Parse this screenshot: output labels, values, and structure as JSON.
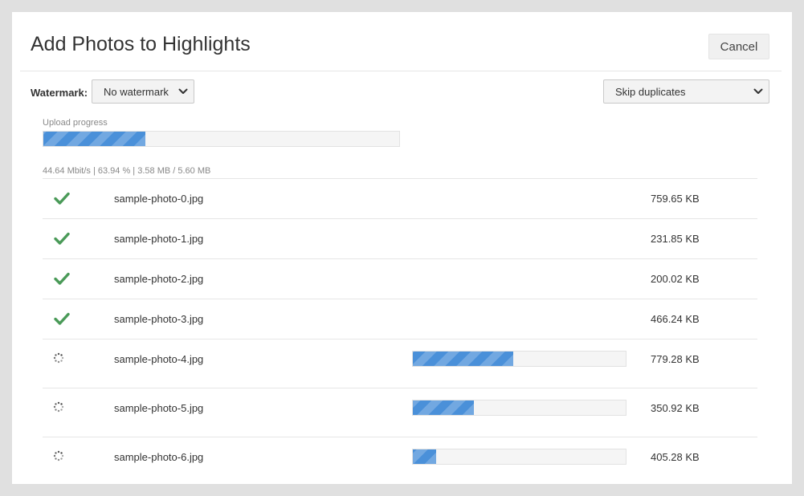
{
  "dialog": {
    "title": "Add Photos to Highlights",
    "cancel_label": "Cancel"
  },
  "options": {
    "watermark_label": "Watermark:",
    "watermark_value": "No watermark",
    "duplicates_value": "Skip duplicates"
  },
  "upload": {
    "caption": "Upload progress",
    "progress": 0.2875,
    "stats": "44.64 Mbit/s | 63.94 % | 3.58 MB / 5.60 MB"
  },
  "colors": {
    "accent": "#4a90d9",
    "success": "#4a9a58"
  },
  "files": [
    {
      "name": "sample-photo-0.jpg",
      "size": "759.65 KB",
      "status": "done",
      "icon": "check-icon"
    },
    {
      "name": "sample-photo-1.jpg",
      "size": "231.85 KB",
      "status": "done",
      "icon": "check-icon"
    },
    {
      "name": "sample-photo-2.jpg",
      "size": "200.02 KB",
      "status": "done",
      "icon": "check-icon"
    },
    {
      "name": "sample-photo-3.jpg",
      "size": "466.24 KB",
      "status": "done",
      "icon": "check-icon"
    },
    {
      "name": "sample-photo-4.jpg",
      "size": "779.28 KB",
      "status": "uploading",
      "icon": "spinner-icon",
      "progress": 0.47
    },
    {
      "name": "sample-photo-5.jpg",
      "size": "350.92 KB",
      "status": "uploading",
      "icon": "spinner-icon",
      "progress": 0.285
    },
    {
      "name": "sample-photo-6.jpg",
      "size": "405.28 KB",
      "status": "uploading",
      "icon": "spinner-icon",
      "progress": 0.11
    }
  ]
}
